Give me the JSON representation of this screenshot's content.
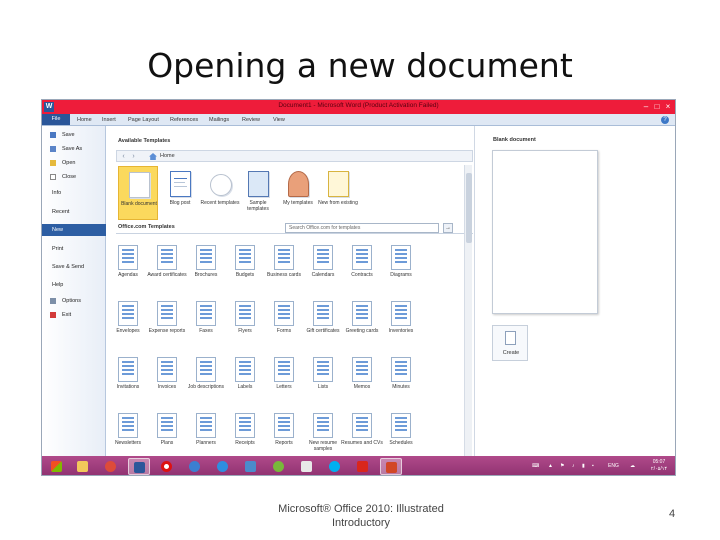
{
  "slide": {
    "title": "Opening a new document",
    "footer_line1": "Microsoft® Office 2010: Illustrated",
    "footer_line2": "Introductory",
    "page_number": "4"
  },
  "window": {
    "title": "Document1 - Microsoft Word (Product Activation Failed)",
    "minimize": "–",
    "maximize": "□",
    "close": "×"
  },
  "ribbon": {
    "tabs": [
      "File",
      "Home",
      "Insert",
      "Page Layout",
      "References",
      "Mailings",
      "Review",
      "View"
    ]
  },
  "backstage": {
    "items": [
      {
        "label": "Save",
        "icon": "save-icon"
      },
      {
        "label": "Save As",
        "icon": "save-as-icon"
      },
      {
        "label": "Open",
        "icon": "open-icon"
      },
      {
        "label": "Close",
        "icon": "close-doc-icon"
      },
      {
        "label": "Info"
      },
      {
        "label": "Recent"
      },
      {
        "label": "New",
        "active": true
      },
      {
        "label": "Print"
      },
      {
        "label": "Save & Send"
      },
      {
        "label": "Help"
      },
      {
        "label": "Options",
        "icon": "options-icon"
      },
      {
        "label": "Exit",
        "icon": "exit-icon"
      }
    ]
  },
  "available_templates": {
    "heading": "Available Templates",
    "nav_location": "Home",
    "items": [
      {
        "label": "Blank document",
        "selected": true
      },
      {
        "label": "Blog post"
      },
      {
        "label": "Recent templates"
      },
      {
        "label": "Sample templates"
      },
      {
        "label": "My templates"
      },
      {
        "label": "New from existing"
      }
    ]
  },
  "office_com": {
    "heading": "Office.com Templates",
    "search_placeholder": "Search Office.com for templates",
    "search_go": "→",
    "items": [
      "Agendas",
      "Award certificates",
      "Brochures",
      "Budgets",
      "Business cards",
      "Calendars",
      "Contracts",
      "Diagrams",
      "Envelopes",
      "Expense reports",
      "Faxes",
      "Flyers",
      "Forms",
      "Gift certificates",
      "Greeting cards",
      "Inventories",
      "Invitations",
      "Invoices",
      "Job descriptions",
      "Labels",
      "Letters",
      "Lists",
      "Memos",
      "Minutes",
      "Newsletters",
      "Plans",
      "Planners",
      "Receipts",
      "Reports",
      "New resume samples",
      "Resumes and CVs",
      "Schedules"
    ]
  },
  "right_panel": {
    "heading": "Blank document",
    "create_label": "Create"
  },
  "taskbar": {
    "lang": "ENG",
    "time": "05:07",
    "date": "۲/۰۵/۱۴"
  },
  "colors": {
    "title_bar": "#ee1c3a",
    "file_tab": "#2a5699",
    "active_sidebar": "#2d5ea3",
    "selected_template": "#fbd95d",
    "taskbar": "#9c3a7c"
  }
}
